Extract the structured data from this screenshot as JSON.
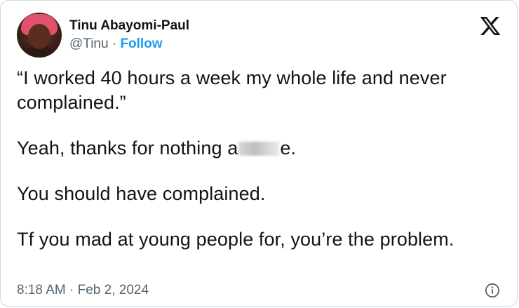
{
  "author": {
    "name": "Tinu Abayomi-Paul",
    "handle": "@Tinu",
    "separator": "·",
    "follow_label": "Follow",
    "avatar_icon": "profile-photo"
  },
  "tweet": {
    "para1": "“I worked 40 hours a week my whole life and never complained.”",
    "para2_before": "Yeah, thanks for nothing a",
    "para2_after": "e.",
    "para3": "You should have complained.",
    "para4": "Tf you mad at young people for, you’re the problem."
  },
  "meta": {
    "time": "8:18 AM",
    "separator": "·",
    "date": "Feb 2, 2024"
  },
  "icons": {
    "brand": "x-logo-icon",
    "info": "info-icon"
  },
  "colors": {
    "link": "#1d9bf0",
    "text": "#0f1419",
    "secondary": "#536471",
    "border": "#cfd9de"
  }
}
